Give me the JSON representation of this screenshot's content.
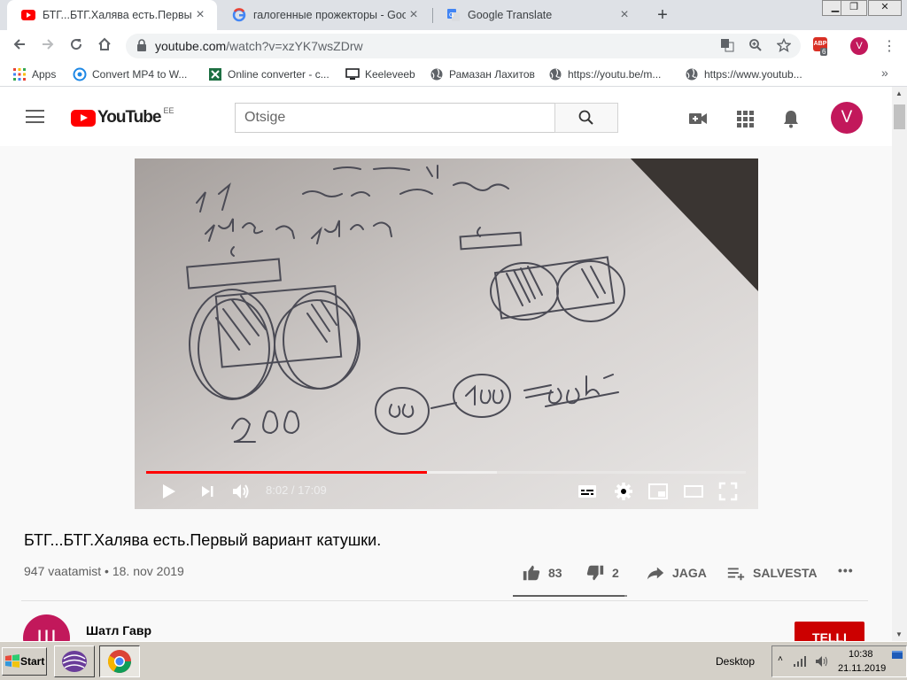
{
  "browser": {
    "tabs": [
      {
        "title": "БТГ...БТГ.Халява есть.Первый ва",
        "icon": "youtube-favicon"
      },
      {
        "title": "галогенные прожекторы - Goog",
        "icon": "google-favicon"
      },
      {
        "title": "Google Translate",
        "icon": "translate-favicon"
      }
    ],
    "url_host": "youtube.com",
    "url_path": "/watch?v=xzYK7wsZDrw",
    "profile_initial": "V",
    "extension_badge": "6",
    "extension_label": "ABP",
    "bookmarks": [
      {
        "label": "Apps",
        "icon": "apps-grid-icon"
      },
      {
        "label": "Convert MP4 to W...",
        "icon": "convert-icon"
      },
      {
        "label": "Online converter - c...",
        "icon": "excel-icon"
      },
      {
        "label": "Keeleveeb",
        "icon": "monitor-icon"
      },
      {
        "label": "Рамазан Лахитов",
        "icon": "globe-icon"
      },
      {
        "label": "https://youtu.be/m...",
        "icon": "globe-icon"
      },
      {
        "label": "https://www.youtub...",
        "icon": "globe-icon"
      }
    ],
    "bookmarks_more": "»"
  },
  "youtube": {
    "logo_text": "YouTube",
    "country_code": "EE",
    "search_placeholder": "Otsige",
    "avatar_initial": "V",
    "player": {
      "time": "8:02 / 17:09",
      "progress": 0.468,
      "buffered": 0.585
    },
    "video_title": "БТГ...БТГ.Халява есть.Первый вариант катушки.",
    "meta": "947 vaatamist • 18. nov 2019",
    "likes": "83",
    "dislikes": "2",
    "like_ratio": 0.976,
    "share_label": "JAGA",
    "save_label": "SALVESTA",
    "more_label": "•••",
    "channel_initial": "Ш",
    "channel_name": "Шатл Гавр",
    "subscribe_label": "TELLI"
  },
  "taskbar": {
    "start_label": "Start",
    "desktop_label": "Desktop",
    "time": "10:38",
    "date": "21.11.2019"
  },
  "colors": {
    "youtube_red": "#ff0000",
    "avatar": "#c2185b",
    "subscribe": "#cc0000"
  }
}
